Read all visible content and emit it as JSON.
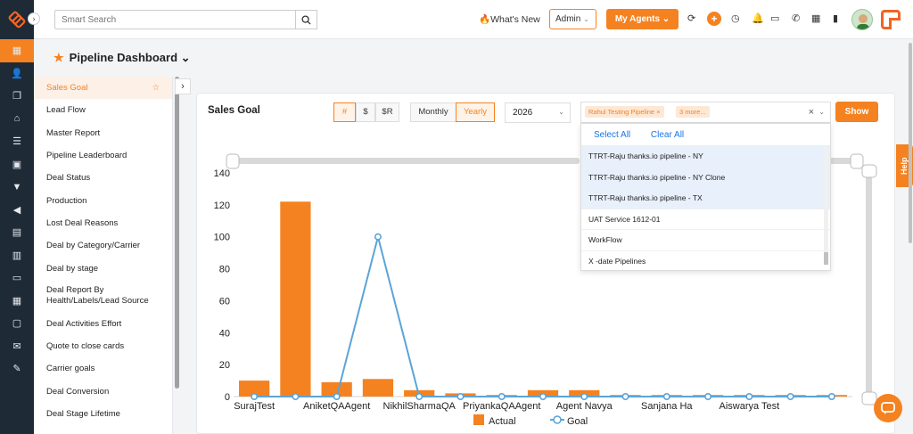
{
  "topbar": {
    "search_placeholder": "Smart Search",
    "whats_new": "What's New",
    "admin_label": "Admin",
    "agents_label": "My Agents"
  },
  "page": {
    "title": "Pipeline Dashboard"
  },
  "report_list": [
    "Sales Goal",
    "Lead Flow",
    "Master Report",
    "Pipeline Leaderboard",
    "Deal Status",
    "Production",
    "Lost Deal Reasons",
    "Deal by Category/Carrier",
    "Deal by stage",
    "Deal Report By Health/Labels/Lead Source",
    "Deal Activities Effort",
    "Quote to close cards",
    "Carrier goals",
    "Deal Conversion",
    "Deal Stage Lifetime"
  ],
  "card": {
    "title": "Sales Goal",
    "metric_tabs": [
      "#",
      "$",
      "$R"
    ],
    "period_tabs": [
      "Monthly",
      "Yearly"
    ],
    "year": "2026",
    "pipeline_tag": "Rahul Testing Pipeline",
    "more_tag": "3 more...",
    "show_label": "Show"
  },
  "dropdown": {
    "select_all": "Select All",
    "clear_all": "Clear All",
    "options": [
      {
        "label": "TTRT-Raju thanks.io pipeline - NY",
        "selected": true
      },
      {
        "label": "TTRT-Raju thanks.io pipeline - NY Clone",
        "selected": true
      },
      {
        "label": "TTRT-Raju thanks.io pipeline - TX",
        "selected": true
      },
      {
        "label": "UAT Service 1612-01",
        "selected": false
      },
      {
        "label": "WorkFlow",
        "selected": false
      },
      {
        "label": "X -date Pipelines",
        "selected": false
      }
    ]
  },
  "help_label": "Help",
  "colors": {
    "accent": "#f58220",
    "goal_line": "#5ba4d8",
    "rail": "#1f2a37"
  },
  "chart_data": {
    "type": "bar",
    "categories": [
      "SurajTest",
      "",
      "AniketQAAgent",
      "",
      "NikhilSharmaQA",
      "",
      "PriyankaQAAgent",
      "",
      "Agent Navya",
      "",
      "Sanjana Ha",
      "",
      "Aiswarya Test",
      "",
      ""
    ],
    "x_tick_labels": [
      "SurajTest",
      "AniketQAAgent",
      "NikhilSharmaQA",
      "PriyankaQAAgent",
      "Agent Navya",
      "Sanjana Ha",
      "Aiswarya Test"
    ],
    "series": [
      {
        "name": "Actual",
        "values": [
          10,
          122,
          9,
          11,
          4,
          2,
          1,
          4,
          4,
          1,
          1,
          1,
          1,
          1,
          1
        ]
      },
      {
        "name": "Goal",
        "values": [
          0,
          0,
          0,
          100,
          0,
          0,
          0,
          0,
          0,
          0,
          0,
          0,
          0,
          0,
          0
        ]
      }
    ],
    "y_ticks": [
      0,
      20,
      40,
      60,
      80,
      100,
      120,
      140
    ],
    "ylim": [
      0,
      140
    ],
    "legend_position": "bottom"
  }
}
